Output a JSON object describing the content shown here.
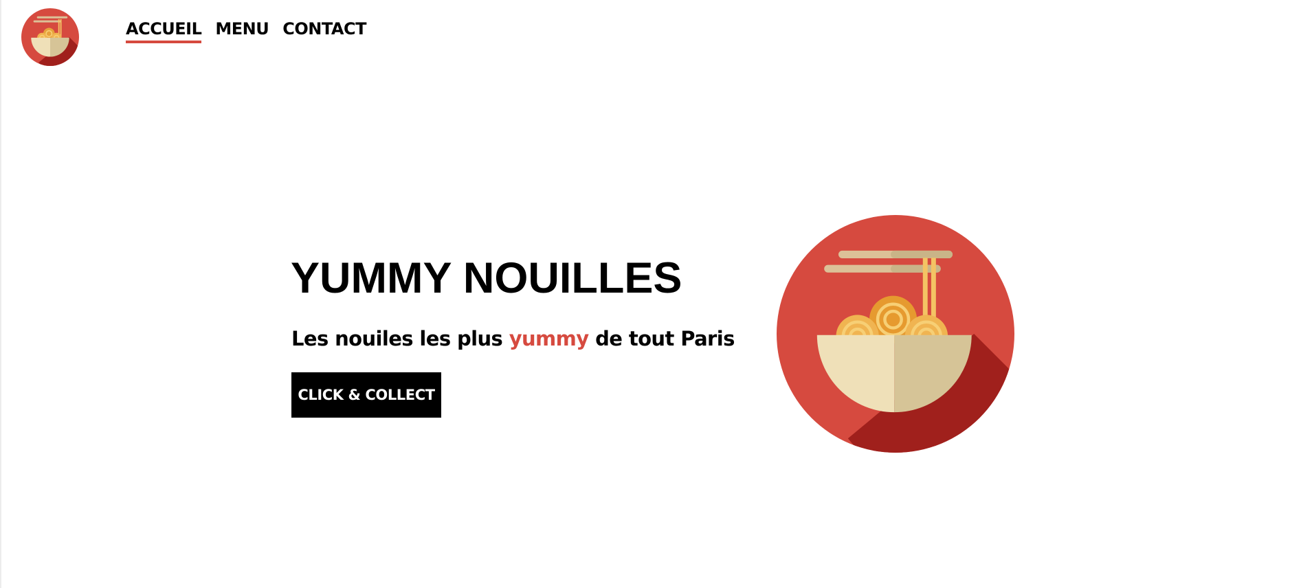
{
  "brand": {
    "logo_icon": "noodle-bowl-icon",
    "accent_color": "#d64a3f"
  },
  "nav": {
    "items": [
      {
        "label": "ACCUEIL",
        "active": true
      },
      {
        "label": "MENU",
        "active": false
      },
      {
        "label": "CONTACT",
        "active": false
      }
    ]
  },
  "hero": {
    "title": "YUMMY NOUILLES",
    "subtitle_before": "Les nouiles les plus ",
    "subtitle_accent": "yummy",
    "subtitle_after": " de tout Paris",
    "cta_label": "CLICK & COLLECT",
    "image_icon": "noodle-bowl-icon"
  }
}
